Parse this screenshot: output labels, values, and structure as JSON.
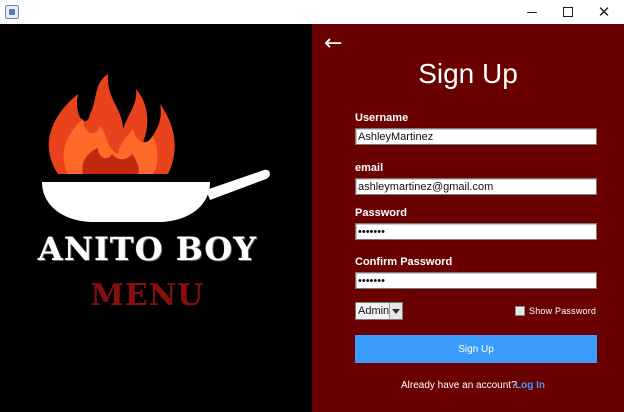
{
  "window": {
    "minimize_icon": "minimize-icon",
    "maximize_icon": "maximize-icon",
    "close_icon": "close-icon",
    "close_glyph": "✕"
  },
  "brand": {
    "name": "Anito Boy",
    "subtitle": "Menu",
    "logo_icon": "flaming-pan-icon"
  },
  "form": {
    "back_glyph": "←",
    "title": "Sign Up",
    "username_label": "Username",
    "username_value": "AshleyMartinez",
    "email_label": "email",
    "email_value": "ashleymartinez@gmail.com",
    "password_label": "Password",
    "password_value": "•••••••",
    "confirm_label": "Confirm Password",
    "confirm_value": "•••••••",
    "role_value": "Admin",
    "show_password_label": "Show Password",
    "show_password_checked": false,
    "submit_label": "Sign Up",
    "footer_text": "Already have an account?",
    "login_link": "Log In"
  },
  "colors": {
    "left_bg": "#000000",
    "right_bg": "#6b0000",
    "accent": "#3b9cfc",
    "brand_red": "#8b0e0e"
  }
}
